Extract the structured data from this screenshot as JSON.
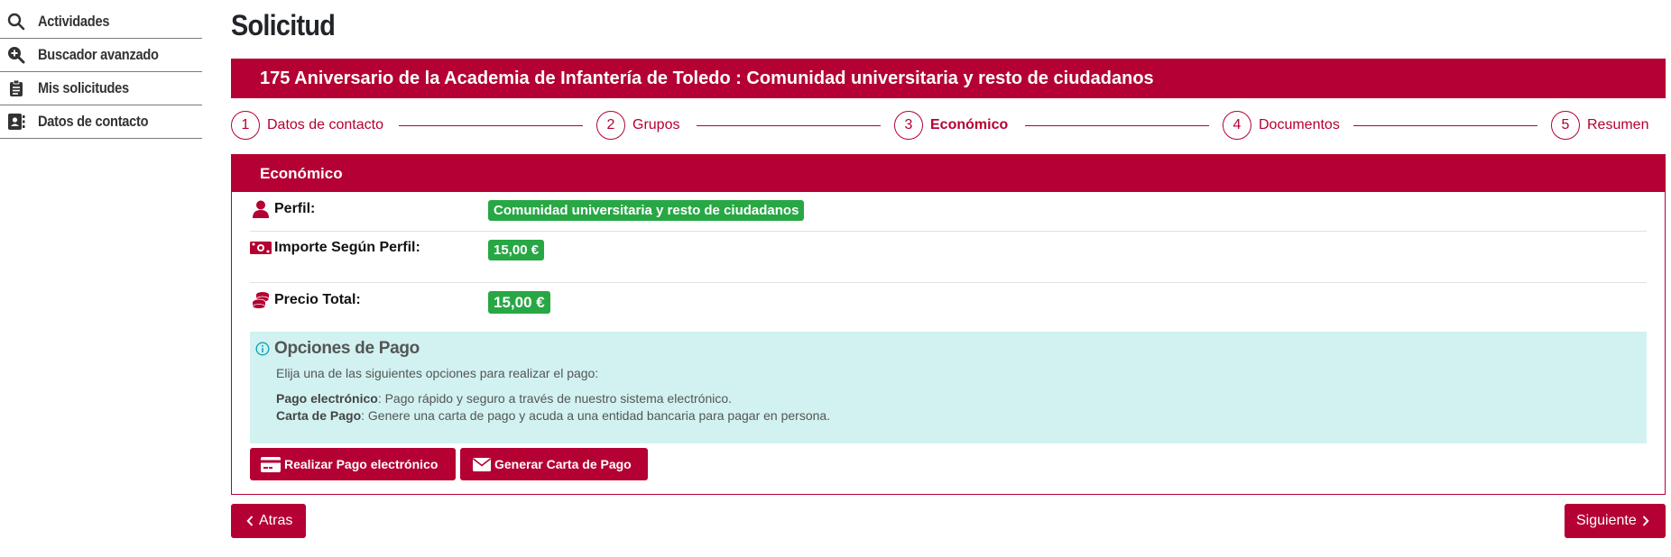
{
  "sidebar": {
    "items": [
      {
        "label": "Actividades",
        "icon": "search-icon"
      },
      {
        "label": "Buscador avanzado",
        "icon": "zoom-in-icon"
      },
      {
        "label": "Mis solicitudes",
        "icon": "clipboard-icon"
      },
      {
        "label": "Datos de contacto",
        "icon": "address-book-icon"
      }
    ]
  },
  "page": {
    "title": "Solicitud",
    "event_title": "175 Aniversario de la Academia de Infantería de Toledo : Comunidad universitaria y resto de ciudadanos"
  },
  "stepper": {
    "steps": [
      {
        "number": "1",
        "label": "Datos de contacto"
      },
      {
        "number": "2",
        "label": "Grupos"
      },
      {
        "number": "3",
        "label": "Económico"
      },
      {
        "number": "4",
        "label": "Documentos"
      },
      {
        "number": "5",
        "label": "Resumen"
      }
    ],
    "active": "Económico"
  },
  "economico": {
    "header": "Económico",
    "perfil_label": "Perfil:",
    "perfil_value": "Comunidad universitaria y resto de ciudadanos",
    "importe_label": "Importe Según Perfil:",
    "importe_value": "15,00 €",
    "total_label": "Precio Total:",
    "total_value": "15,00 €"
  },
  "payment": {
    "title": "Opciones de Pago",
    "intro": "Elija una de las siguientes opciones para realizar el pago:",
    "option1_name": "Pago electrónico",
    "option1_desc": ": Pago rápido y seguro a través de nuestro sistema electrónico.",
    "option2_name": "Carta de Pago",
    "option2_desc": ": Genere una carta de pago y acuda a una entidad bancaria para pagar en persona.",
    "btn_electronic": "Realizar Pago electrónico",
    "btn_letter": "Generar Carta de Pago"
  },
  "nav": {
    "back": "Atras",
    "next": "Siguiente"
  },
  "colors": {
    "brand": "#b40032",
    "badge_green": "#28a745",
    "info_bg": "#d1f2f0"
  }
}
